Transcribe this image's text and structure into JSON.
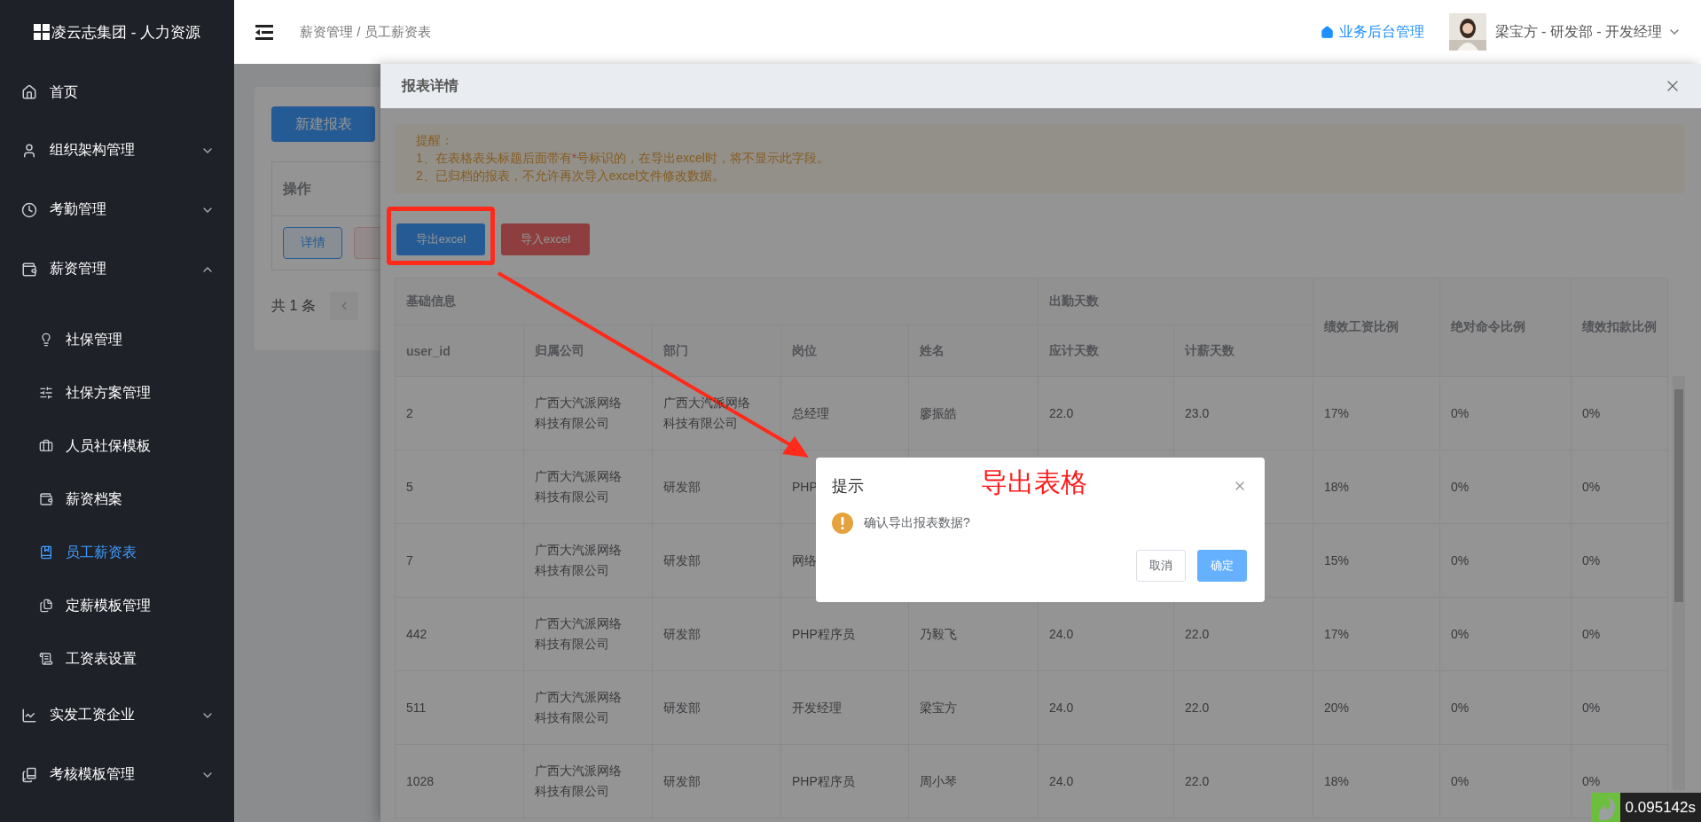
{
  "sidebar": {
    "brand": "凌云志集团 - 人力资源",
    "items": [
      {
        "label": "首页",
        "kind": "link"
      },
      {
        "label": "组织架构管理",
        "kind": "group",
        "expanded": false
      },
      {
        "label": "考勤管理",
        "kind": "group",
        "expanded": false
      },
      {
        "label": "薪资管理",
        "kind": "group",
        "expanded": true,
        "children": [
          {
            "label": "社保管理",
            "selected": false
          },
          {
            "label": "社保方案管理",
            "selected": false
          },
          {
            "label": "人员社保模板",
            "selected": false
          },
          {
            "label": "薪资档案",
            "selected": false
          },
          {
            "label": "员工薪资表",
            "selected": true
          },
          {
            "label": "定薪模板管理",
            "selected": false
          },
          {
            "label": "工资表设置",
            "selected": false
          }
        ]
      },
      {
        "label": "实发工资企业",
        "kind": "group",
        "expanded": false
      },
      {
        "label": "考核模板管理",
        "kind": "group",
        "expanded": false
      }
    ]
  },
  "header": {
    "breadcrumb": "薪资管理 / 员工薪资表",
    "admin_link": "业务后台管理",
    "user": "梁宝方 - 研发部 - 开发经理"
  },
  "background_page": {
    "new_button": "新建报表",
    "column": "操作",
    "row_button": "详情",
    "total": "共 1 条"
  },
  "drawer": {
    "title": "报表详情",
    "notice": {
      "title": "提醒：",
      "lines": [
        {
          "before": "1、在表格表头标题后面带有",
          "mark": "*",
          "after": "号标识的，在导出excel时，将不显示此字段。"
        },
        {
          "before": "2、已归档的报表，不允许再次导入excel文件修改数据。"
        }
      ]
    },
    "buttons": [
      {
        "label": "导出excel",
        "kind": "primary"
      },
      {
        "label": "导入excel",
        "kind": "danger"
      }
    ],
    "table": {
      "groups": [
        {
          "label": "基础信息",
          "columns": [
            "user_id",
            "归属公司",
            "部门",
            "岗位",
            "姓名"
          ]
        },
        {
          "label": "出勤天数",
          "columns": [
            "应计天数",
            "计薪天数"
          ]
        },
        {
          "label": "绩效工资比例"
        },
        {
          "label": "绝对命令比例"
        },
        {
          "label": "绩效扣款比例"
        }
      ],
      "rows": [
        [
          "2",
          "广西大汽派网络科技有限公司",
          "广西大汽派网络科技有限公司",
          "总经理",
          "廖振皓",
          "22.0",
          "23.0",
          "17%",
          "0%",
          "0%"
        ],
        [
          "5",
          "广西大汽派网络科技有限公司",
          "研发部",
          "PHP",
          null,
          null,
          null,
          "18%",
          "0%",
          "0%"
        ],
        [
          "7",
          "广西大汽派网络科技有限公司",
          "研发部",
          "网络",
          null,
          null,
          null,
          "15%",
          "0%",
          "0%"
        ],
        [
          "442",
          "广西大汽派网络科技有限公司",
          "研发部",
          "PHP程序员",
          "乃毅飞",
          "24.0",
          "22.0",
          "17%",
          "0%",
          "0%"
        ],
        [
          "511",
          "广西大汽派网络科技有限公司",
          "研发部",
          "开发经理",
          "梁宝方",
          "24.0",
          "22.0",
          "20%",
          "0%",
          "0%"
        ],
        [
          "1028",
          "广西大汽派网络科技有限公司",
          "研发部",
          "PHP程序员",
          "周小琴",
          "24.0",
          "22.0",
          "18%",
          "0%",
          "0%"
        ]
      ]
    }
  },
  "dialog": {
    "title": "提示",
    "message": "确认导出报表数据?",
    "buttons": [
      {
        "label": "取消",
        "kind": "default"
      },
      {
        "label": "确定",
        "kind": "primary"
      }
    ]
  },
  "annotation": {
    "text": "导出表格"
  },
  "timer": "0.095142s"
}
